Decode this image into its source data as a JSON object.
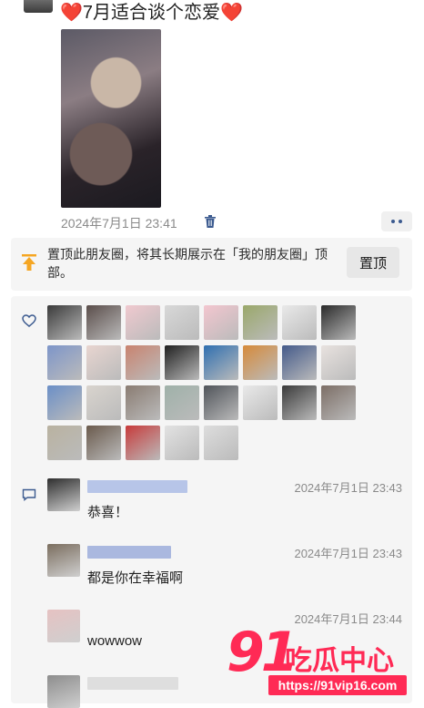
{
  "post": {
    "text": "7月适合谈个恋爱",
    "heart_left": "❤️",
    "heart_right": "❤️",
    "timestamp": "2024年7月1日 23:41"
  },
  "pin_banner": {
    "message": "置顶此朋友圈，将其长期展示在「我的朋友圈」顶部。",
    "button_label": "置顶"
  },
  "likes": {
    "icon": "heart-outline-icon",
    "avatar_colors": [
      "#3a3a3a",
      "#5a4d4a",
      "#f0c9cf",
      "#d8d8d8",
      "#f3c6cf",
      "#9aa86a",
      "#e9e9e9",
      "#2a2a2a",
      "#7d95c9",
      "#e8d5d0",
      "#c9836f",
      "#1f1f1f",
      "#2f6fb0",
      "#d68a3a",
      "#445a8a",
      "#e8e2df",
      "#6b8fc7",
      "#d9d4ce",
      "#8a7c72",
      "#9fb1a9",
      "#50545a",
      "#e9e9e9",
      "#3a3a3a",
      "#7c6e66",
      "#b9b2a0",
      "#6a5a4c",
      "#c73a3a",
      "#e2e2e2",
      "#dddddd"
    ]
  },
  "comments": [
    {
      "time": "2024年7月1日 23:43",
      "text": "恭喜！",
      "avatar_color": "#2f2f2f",
      "name_color": "#b7c5e8"
    },
    {
      "time": "2024年7月1日 23:43",
      "text": "都是你在幸福啊",
      "avatar_color": "#7b6e5f",
      "name_color": "#aab8df"
    },
    {
      "time": "2024年7月1日 23:44",
      "text": "wowwow",
      "avatar_color": "#e6c2c2",
      "name_color": "#d9d9d9"
    },
    {
      "time": "",
      "text": "",
      "avatar_color": "#8d8d8d",
      "name_color": "#dedede"
    }
  ],
  "icons": {
    "trash": "trash-icon",
    "more": "more-icon",
    "pin": "pin-up-icon",
    "comment": "comment-icon"
  },
  "watermark": {
    "number": "91",
    "brand": "吃瓜中心",
    "url": "https://91vip16.com"
  },
  "colors": {
    "accent_blue": "#3b5a8f",
    "watermark_red": "#ff2a55",
    "panel_bg": "#f5f5f5"
  }
}
